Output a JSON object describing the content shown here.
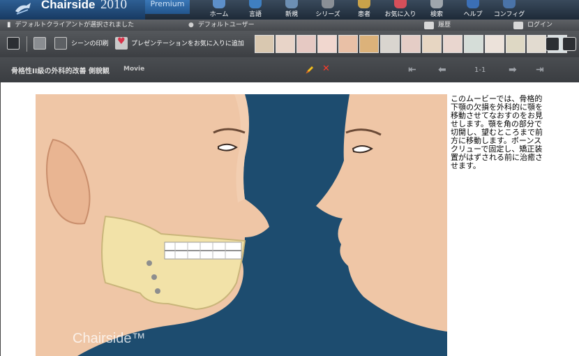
{
  "app": {
    "brand_name": "Chairside",
    "brand_year": "2010",
    "edition": "Premium"
  },
  "nav": [
    {
      "label": "ホーム",
      "icon": "home-icon",
      "color": "#5d8fc9"
    },
    {
      "label": "言語",
      "icon": "language-icon",
      "color": "#3f7fc0"
    },
    {
      "label": "新規",
      "icon": "new-icon",
      "color": "#6d8fb3"
    },
    {
      "label": "シリーズ",
      "icon": "series-icon",
      "color": "#8a8f96"
    },
    {
      "label": "患者",
      "icon": "patient-icon",
      "color": "#c9a24a"
    },
    {
      "label": "お気に入り",
      "icon": "favorite-icon",
      "color": "#d64f5a"
    },
    {
      "label": "検索",
      "icon": "search-icon",
      "color": "#9fa6ad"
    },
    {
      "label": "ヘルプ",
      "icon": "help-icon",
      "color": "#3b6fb6"
    },
    {
      "label": "コンフィグ",
      "icon": "config-icon",
      "color": "#4a73a8"
    }
  ],
  "statusbar": {
    "client": "デフォルトクライアントが選択されました",
    "user": "デフォルトユーザー",
    "history": "履歴",
    "login": "ログイン"
  },
  "toolbar": {
    "print_scene": "シーンの印刷",
    "add_presentation": "プレゼンテーションをお気に入りに追加",
    "thumbnail_colors": [
      "#d9c8b0",
      "#e8d4c8",
      "#e6c9c3",
      "#f1d7cf",
      "#e9c0a6",
      "#dcb27a",
      "#d9d5cf",
      "#e5cdc6",
      "#e7d6c2",
      "#e9d6cf",
      "#d5ddd8",
      "#ece2da",
      "#ded8c4",
      "#e2dbd0",
      "#d8e0e2"
    ]
  },
  "title": {
    "text": "骨格性II級の外科的改善 側貌観",
    "kind": "Movie",
    "page_count": "1-1"
  },
  "description": "このムービーでは、骨格的下顎の欠損を外科的に顎を移動させてなおすのをお見せします。顎を角の部分で切開し、望むところまで前方に移動します。ボーンスクリューで固定し、矯正装置がはずされる前に治癒させます。",
  "movie": {
    "watermark": "Chairside™",
    "background_color": "#1d4c6f"
  }
}
